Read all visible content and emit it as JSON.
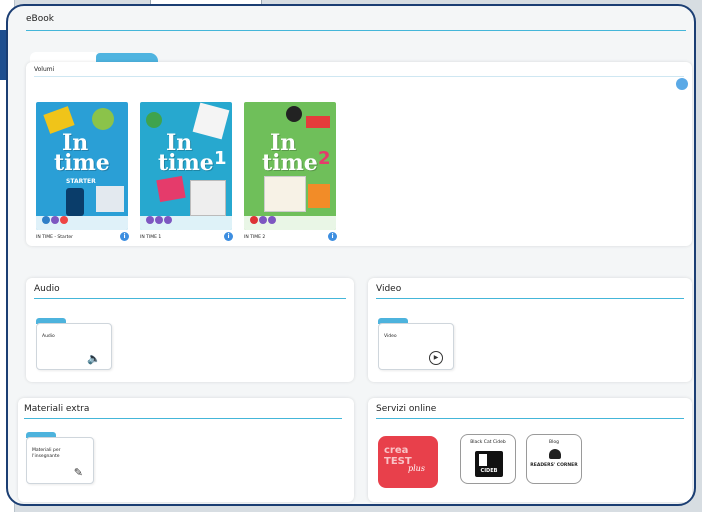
{
  "header": {
    "title": "eBook"
  },
  "volumes": {
    "title": "Volumi",
    "books": [
      {
        "label": "IN TIME - Starter",
        "cover_word1": "In",
        "cover_word2": "time",
        "cover_sub": "STARTER",
        "number": "",
        "color": "#2a9fd6"
      },
      {
        "label": "IN TIME 1",
        "cover_word1": "In",
        "cover_word2": "time",
        "cover_sub": "",
        "number": "1",
        "color": "#27a8cf"
      },
      {
        "label": "IN TIME 2",
        "cover_word1": "In",
        "cover_word2": "time",
        "cover_sub": "",
        "number": "2",
        "color": "#6fbf5a"
      }
    ],
    "info_glyph": "i"
  },
  "audio": {
    "title": "Audio",
    "folder_label": "Audio",
    "icon": "speaker-icon",
    "glyph": "🔈"
  },
  "video": {
    "title": "Video",
    "folder_label": "Video",
    "icon": "play-circle-icon",
    "glyph": "▶"
  },
  "extra": {
    "title": "Materiali extra",
    "folder_label": "Materiali per l'insegnante",
    "icon": "pencil-icon",
    "glyph": "✎"
  },
  "services": {
    "title": "Servizi online",
    "items": [
      {
        "label": "",
        "logo_text1": "crea",
        "logo_text2": "TEST",
        "logo_text3": "plus"
      },
      {
        "label": "Black Cat Cideb",
        "logo_text": "CIDEB"
      },
      {
        "label": "Blog",
        "logo_text": "READERS' CORNER"
      }
    ]
  },
  "colors": {
    "frame": "#1b3e73",
    "accent": "#44b6d9",
    "createst": "#e8404b"
  }
}
